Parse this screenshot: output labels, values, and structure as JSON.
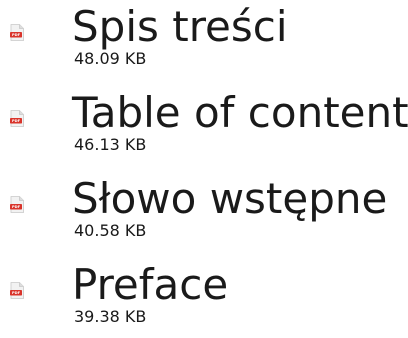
{
  "files": [
    {
      "name": "Spis treści",
      "size": "48.09 KB",
      "icon": "pdf-file-icon"
    },
    {
      "name": "Table of content",
      "size": "46.13 KB",
      "icon": "pdf-file-icon"
    },
    {
      "name": "Słowo wstępne",
      "size": "40.58 KB",
      "icon": "pdf-file-icon"
    },
    {
      "name": "Preface",
      "size": "39.38 KB",
      "icon": "pdf-file-icon"
    }
  ],
  "colors": {
    "icon_red": "#d9342b",
    "icon_page": "#f2f2f2",
    "text": "#1a1a1a"
  }
}
